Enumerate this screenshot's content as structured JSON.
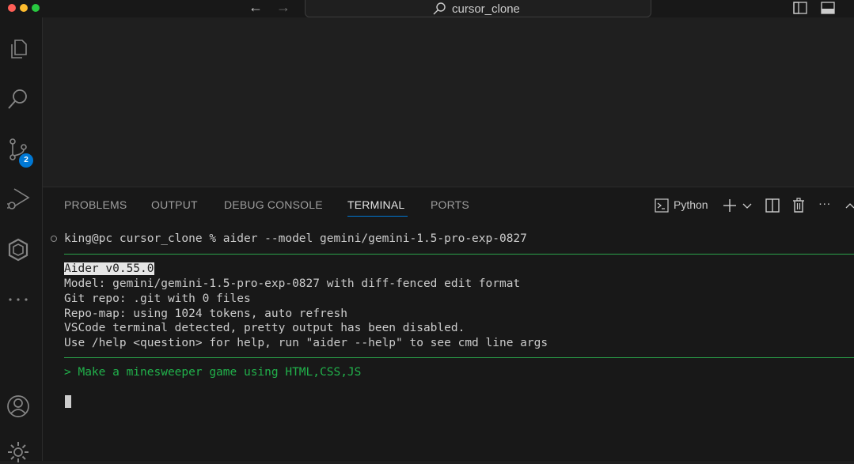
{
  "window": {
    "search_label": "cursor_clone"
  },
  "activity_bar": {
    "items": [
      {
        "name": "explorer-icon"
      },
      {
        "name": "search-icon"
      },
      {
        "name": "source-control-icon",
        "badge": "2"
      },
      {
        "name": "run-debug-icon"
      },
      {
        "name": "remote-icon"
      },
      {
        "name": "more-icon"
      },
      {
        "name": "account-icon"
      },
      {
        "name": "manage-gear-icon"
      }
    ]
  },
  "panel": {
    "tabs": [
      {
        "label": "PROBLEMS"
      },
      {
        "label": "OUTPUT"
      },
      {
        "label": "DEBUG CONSOLE"
      },
      {
        "label": "TERMINAL",
        "active": true
      },
      {
        "label": "PORTS"
      }
    ],
    "terminal_profile": "Python",
    "more_label": "···"
  },
  "terminal": {
    "command": "king@pc cursor_clone % aider --model gemini/gemini-1.5-pro-exp-0827",
    "output": [
      "Aider v0.55.0",
      "Model: gemini/gemini-1.5-pro-exp-0827 with diff-fenced edit format",
      "Git repo: .git with 0 files",
      "Repo-map: using 1024 tokens, auto refresh",
      "VSCode terminal detected, pretty output has been disabled.",
      "Use /help <question> for help, run \"aider --help\" to see cmd line args"
    ],
    "prompt": "> Make a minesweeper game using HTML,CSS,JS"
  },
  "colors": {
    "accent": "#0078d4",
    "terminal_green": "#21b14b",
    "background": "#1f1f1f"
  }
}
